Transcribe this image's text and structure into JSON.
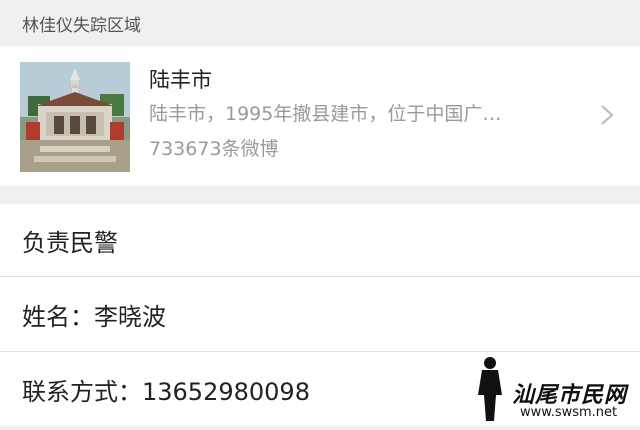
{
  "section": {
    "title": "林佳仪失踪区域"
  },
  "place": {
    "name": "陆丰市",
    "description": "陆丰市，1995年撤县建市，位于中国广…",
    "stat": "733673条微博",
    "thumbnail_icon": "pagoda-photo"
  },
  "police": {
    "header": "负责民警",
    "name_line": "姓名：李晓波",
    "contact_line": "联系方式：13652980098"
  },
  "watermark": {
    "title": "汕尾市民网",
    "url": "www.swsm.net"
  },
  "colors": {
    "background": "#f0f0f2",
    "card": "#ffffff",
    "secondary_text": "#9a9a9a",
    "primary_text": "#222222"
  }
}
